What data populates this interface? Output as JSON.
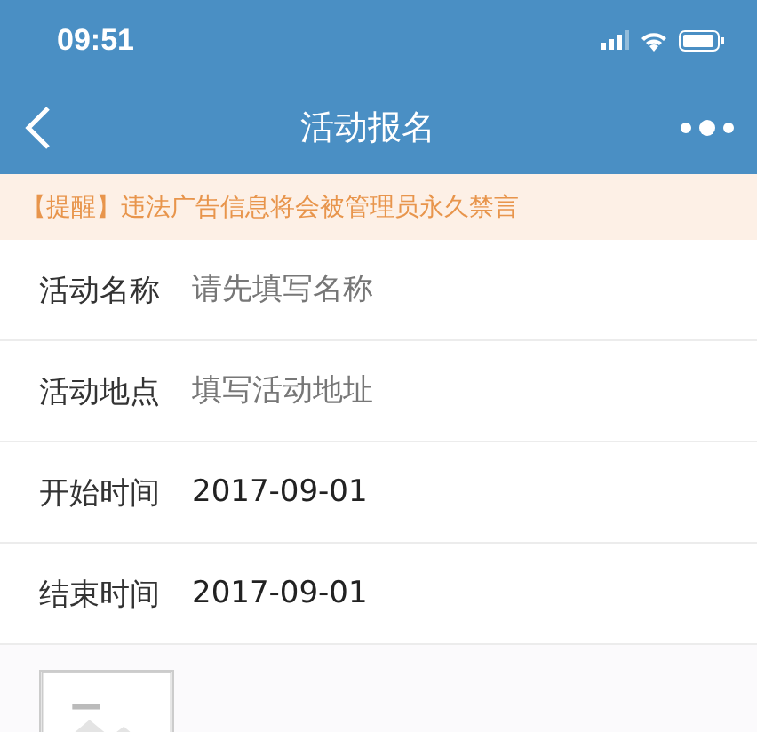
{
  "status_bar": {
    "time": "09:51"
  },
  "nav_bar": {
    "title": "活动报名"
  },
  "notice": "【提醒】违法广告信息将会被管理员永久禁言",
  "fields": [
    {
      "label": "活动名称",
      "placeholder": "请先填写名称"
    },
    {
      "label": "活动地点",
      "placeholder": "填写活动地址"
    },
    {
      "label": "开始时间",
      "value": "2017-09-01"
    },
    {
      "label": "结束时间",
      "value": "2017-09-01"
    }
  ]
}
